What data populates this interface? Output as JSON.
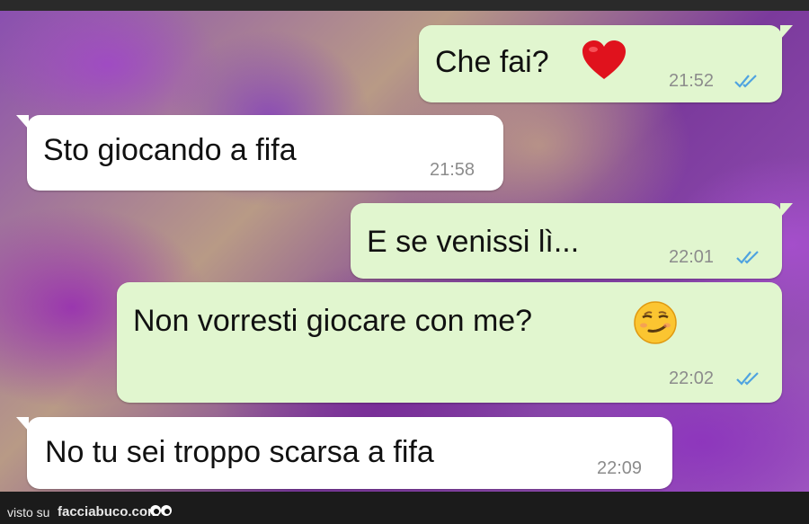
{
  "messages": [
    {
      "id": "m1",
      "direction": "outgoing",
      "text": "Che fai?",
      "emoji": "heart",
      "time": "21:52",
      "status": "read"
    },
    {
      "id": "m2",
      "direction": "incoming",
      "text": "Sto giocando a fifa",
      "time": "21:58"
    },
    {
      "id": "m3",
      "direction": "outgoing",
      "text": "E se venissi lì...",
      "time": "22:01",
      "status": "read"
    },
    {
      "id": "m4",
      "direction": "outgoing",
      "text": "Non vorresti giocare con me?",
      "emoji": "smirk",
      "time": "22:02",
      "status": "read"
    },
    {
      "id": "m5",
      "direction": "incoming",
      "text": "No tu sei troppo scarsa a fifa",
      "time": "22:09"
    }
  ],
  "footer": {
    "prefix": "visto su",
    "site": "facciabuco.com"
  },
  "colors": {
    "outgoing_bubble": "#e1f6cf",
    "incoming_bubble": "#ffffff",
    "read_ticks": "#4fa3e0",
    "time_text": "#8c8c8c"
  }
}
